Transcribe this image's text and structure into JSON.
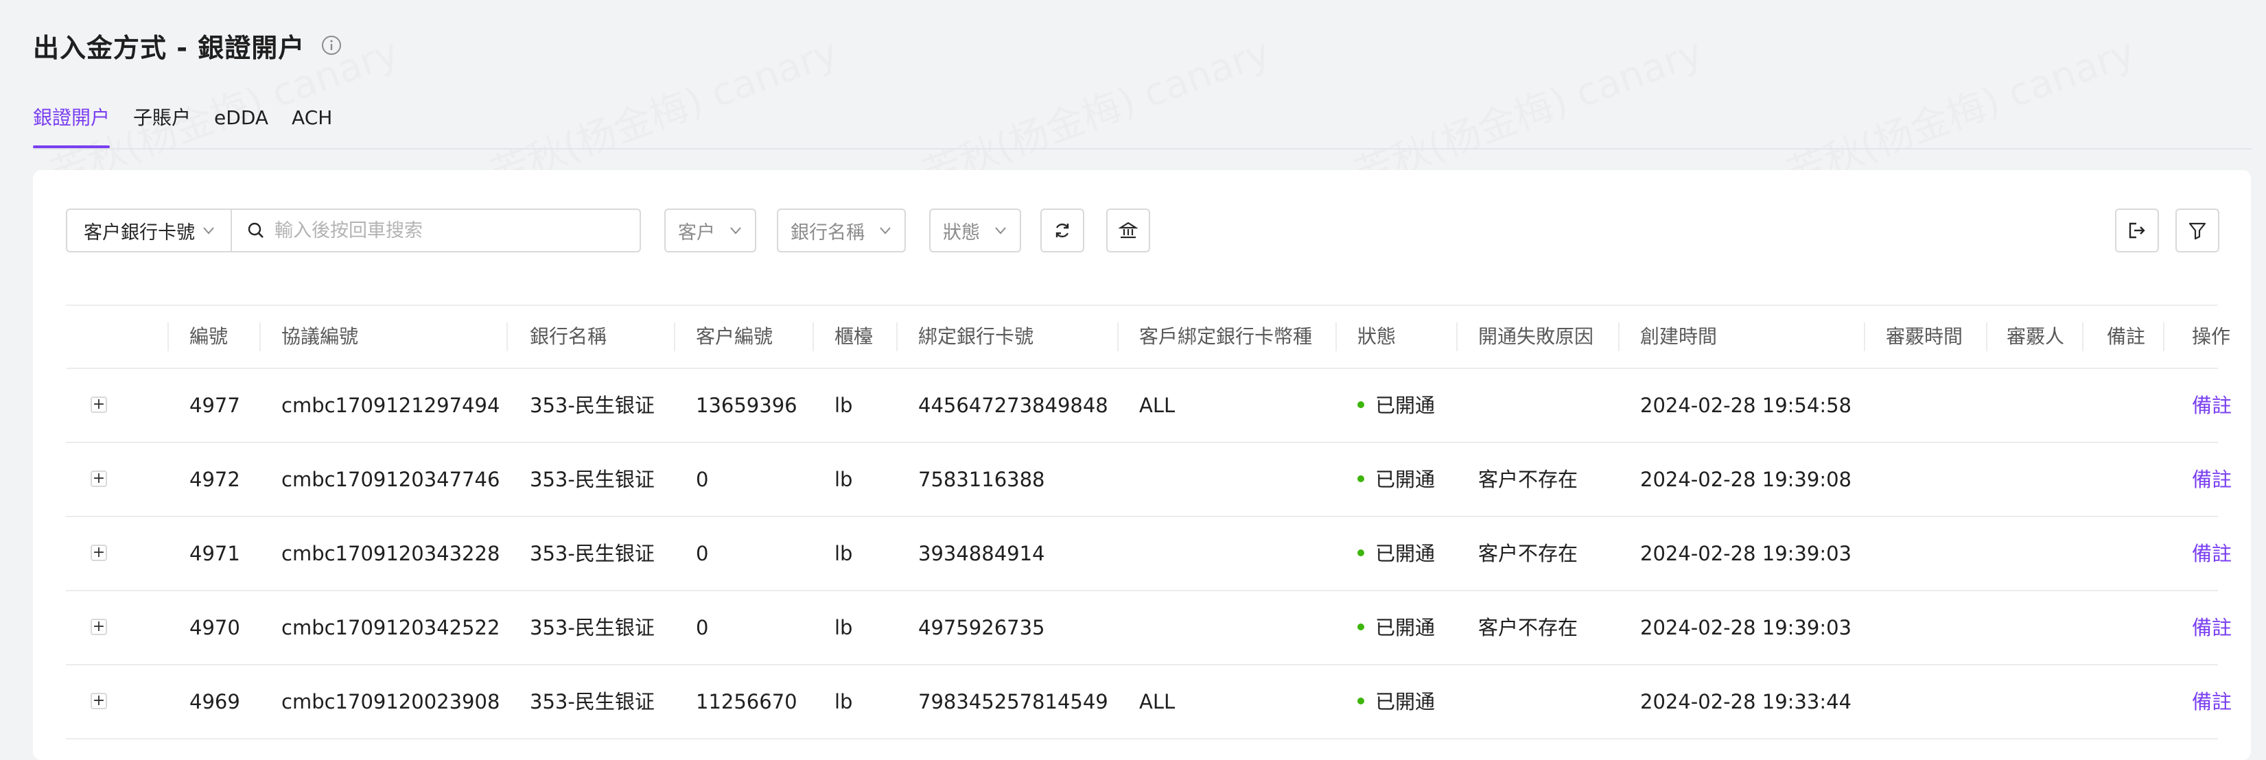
{
  "header": {
    "title": "出入金方式 - 銀證開户"
  },
  "tabs": [
    {
      "label": "銀證開户",
      "active": true
    },
    {
      "label": "子賬户",
      "active": false
    },
    {
      "label": "eDDA",
      "active": false
    },
    {
      "label": "ACH",
      "active": false
    }
  ],
  "toolbar": {
    "filter_field": "客户銀行卡號",
    "search_placeholder": "輸入後按回車搜索",
    "customer_dropdown": "客户",
    "bank_dropdown": "銀行名稱",
    "status_dropdown": "狀態"
  },
  "table": {
    "columns": [
      "編號",
      "協議編號",
      "銀行名稱",
      "客户編號",
      "櫃檯",
      "綁定銀行卡號",
      "客戶綁定銀行卡幣種",
      "狀態",
      "開通失敗原因",
      "創建時間",
      "審覈時間",
      "審覈人",
      "備註",
      "操作"
    ],
    "rows": [
      {
        "id": "4977",
        "agreement": "cmbc1709121297494",
        "bank": "353-民生银证",
        "customer": "13659396",
        "counter": "lb",
        "card": "445647273849848",
        "currency": "ALL",
        "status": "已開通",
        "fail_reason": "",
        "created": "2024-02-28 19:54:58",
        "action": "備註"
      },
      {
        "id": "4972",
        "agreement": "cmbc1709120347746",
        "bank": "353-民生银证",
        "customer": "0",
        "counter": "lb",
        "card": "7583116388",
        "currency": "",
        "status": "已開通",
        "fail_reason": "客户不存在",
        "created": "2024-02-28 19:39:08",
        "action": "備註"
      },
      {
        "id": "4971",
        "agreement": "cmbc1709120343228",
        "bank": "353-民生银证",
        "customer": "0",
        "counter": "lb",
        "card": "3934884914",
        "currency": "",
        "status": "已開通",
        "fail_reason": "客户不存在",
        "created": "2024-02-28 19:39:03",
        "action": "備註"
      },
      {
        "id": "4970",
        "agreement": "cmbc1709120342522",
        "bank": "353-民生银证",
        "customer": "0",
        "counter": "lb",
        "card": "4975926735",
        "currency": "",
        "status": "已開通",
        "fail_reason": "客户不存在",
        "created": "2024-02-28 19:39:03",
        "action": "備註"
      },
      {
        "id": "4969",
        "agreement": "cmbc1709120023908",
        "bank": "353-民生银证",
        "customer": "11256670",
        "counter": "lb",
        "card": "798345257814549",
        "currency": "ALL",
        "status": "已開通",
        "fail_reason": "",
        "created": "2024-02-28 19:33:44",
        "action": "備註"
      }
    ]
  },
  "watermark": "芳秋(杨金梅) canary",
  "colors": {
    "accent": "#7a3ff0",
    "status_green": "#3eb50b"
  }
}
